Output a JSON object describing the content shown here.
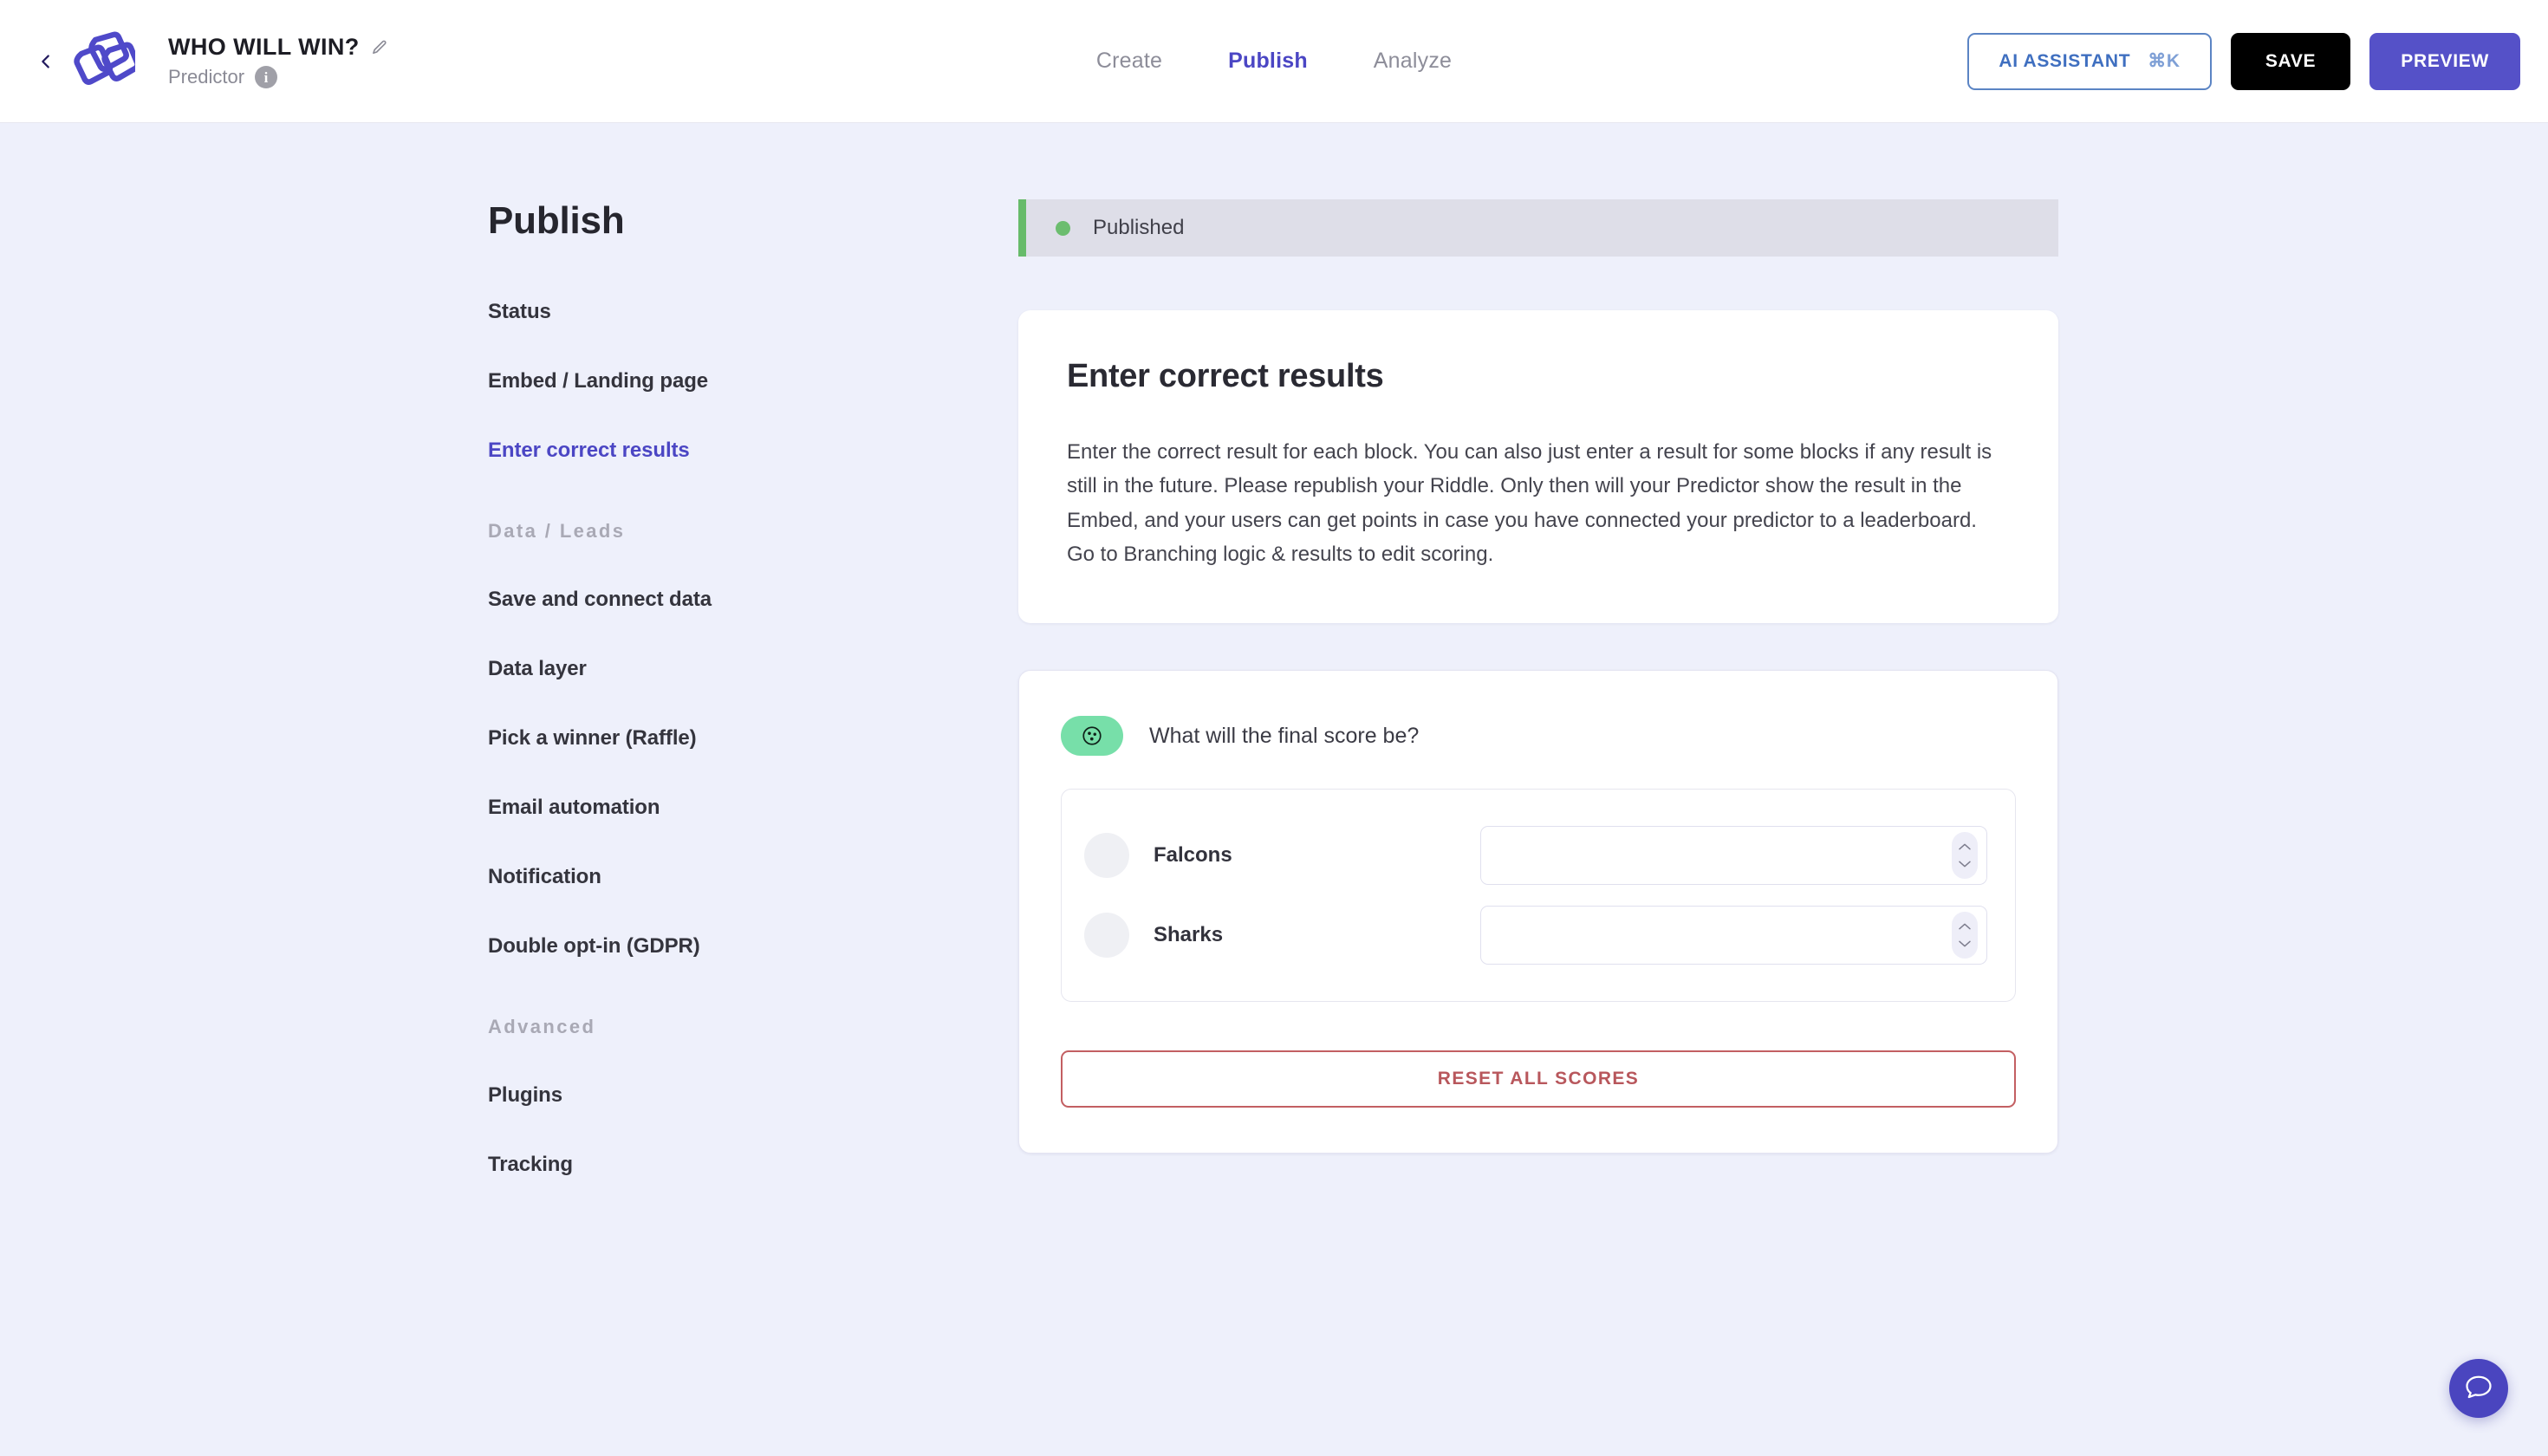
{
  "topbar": {
    "back_icon": "chevron-left-icon",
    "logo_icon": "riddle-logo-icon",
    "riddle_title": "WHO WILL WIN?",
    "edit_icon": "pencil-icon",
    "riddle_type": "Predictor",
    "info_icon": "info-icon",
    "tabs": [
      {
        "label": "Create",
        "active": false
      },
      {
        "label": "Publish",
        "active": true
      },
      {
        "label": "Analyze",
        "active": false
      }
    ],
    "ai_assistant_label": "AI ASSISTANT",
    "ai_assistant_shortcut": "⌘K",
    "save_label": "SAVE",
    "preview_label": "PREVIEW"
  },
  "sidebar": {
    "heading": "Publish",
    "items": [
      {
        "label": "Status",
        "active": false,
        "type": "item"
      },
      {
        "label": "Embed / Landing page",
        "active": false,
        "type": "item"
      },
      {
        "label": "Enter correct results",
        "active": true,
        "type": "item"
      },
      {
        "label": "Data / Leads",
        "type": "group"
      },
      {
        "label": "Save and connect data",
        "active": false,
        "type": "item"
      },
      {
        "label": "Data layer",
        "active": false,
        "type": "item"
      },
      {
        "label": "Pick a winner (Raffle)",
        "active": false,
        "type": "item"
      },
      {
        "label": "Email automation",
        "active": false,
        "type": "item"
      },
      {
        "label": "Notification",
        "active": false,
        "type": "item"
      },
      {
        "label": "Double opt-in (GDPR)",
        "active": false,
        "type": "item"
      },
      {
        "label": "Advanced",
        "type": "group"
      },
      {
        "label": "Plugins",
        "active": false,
        "type": "item"
      },
      {
        "label": "Tracking",
        "active": false,
        "type": "item"
      }
    ]
  },
  "status": {
    "label": "Published",
    "dot_color": "#6cbd6f",
    "accent_color": "#67bb6a"
  },
  "info_card": {
    "title": "Enter correct results",
    "body": "Enter the correct result for each block. You can also just enter a result for some blocks if any result is still in the future. Please republish your Riddle. Only then will your Predictor show the result in the Embed, and your users can get points in case you have connected your predictor to a leaderboard. Go to Branching logic & results to edit scoring."
  },
  "question_card": {
    "badge_icon": "soccer-ball-icon",
    "badge_color": "#77dfa9",
    "question": "What will the final score be?",
    "answers": [
      {
        "name": "Falcons",
        "value": "",
        "placeholder": ""
      },
      {
        "name": "Sharks",
        "value": "",
        "placeholder": ""
      }
    ],
    "reset_label": "RESET ALL SCORES",
    "reset_color": "#b8575c"
  },
  "chat": {
    "icon": "chat-bubble-icon",
    "color": "#4a45bf"
  }
}
